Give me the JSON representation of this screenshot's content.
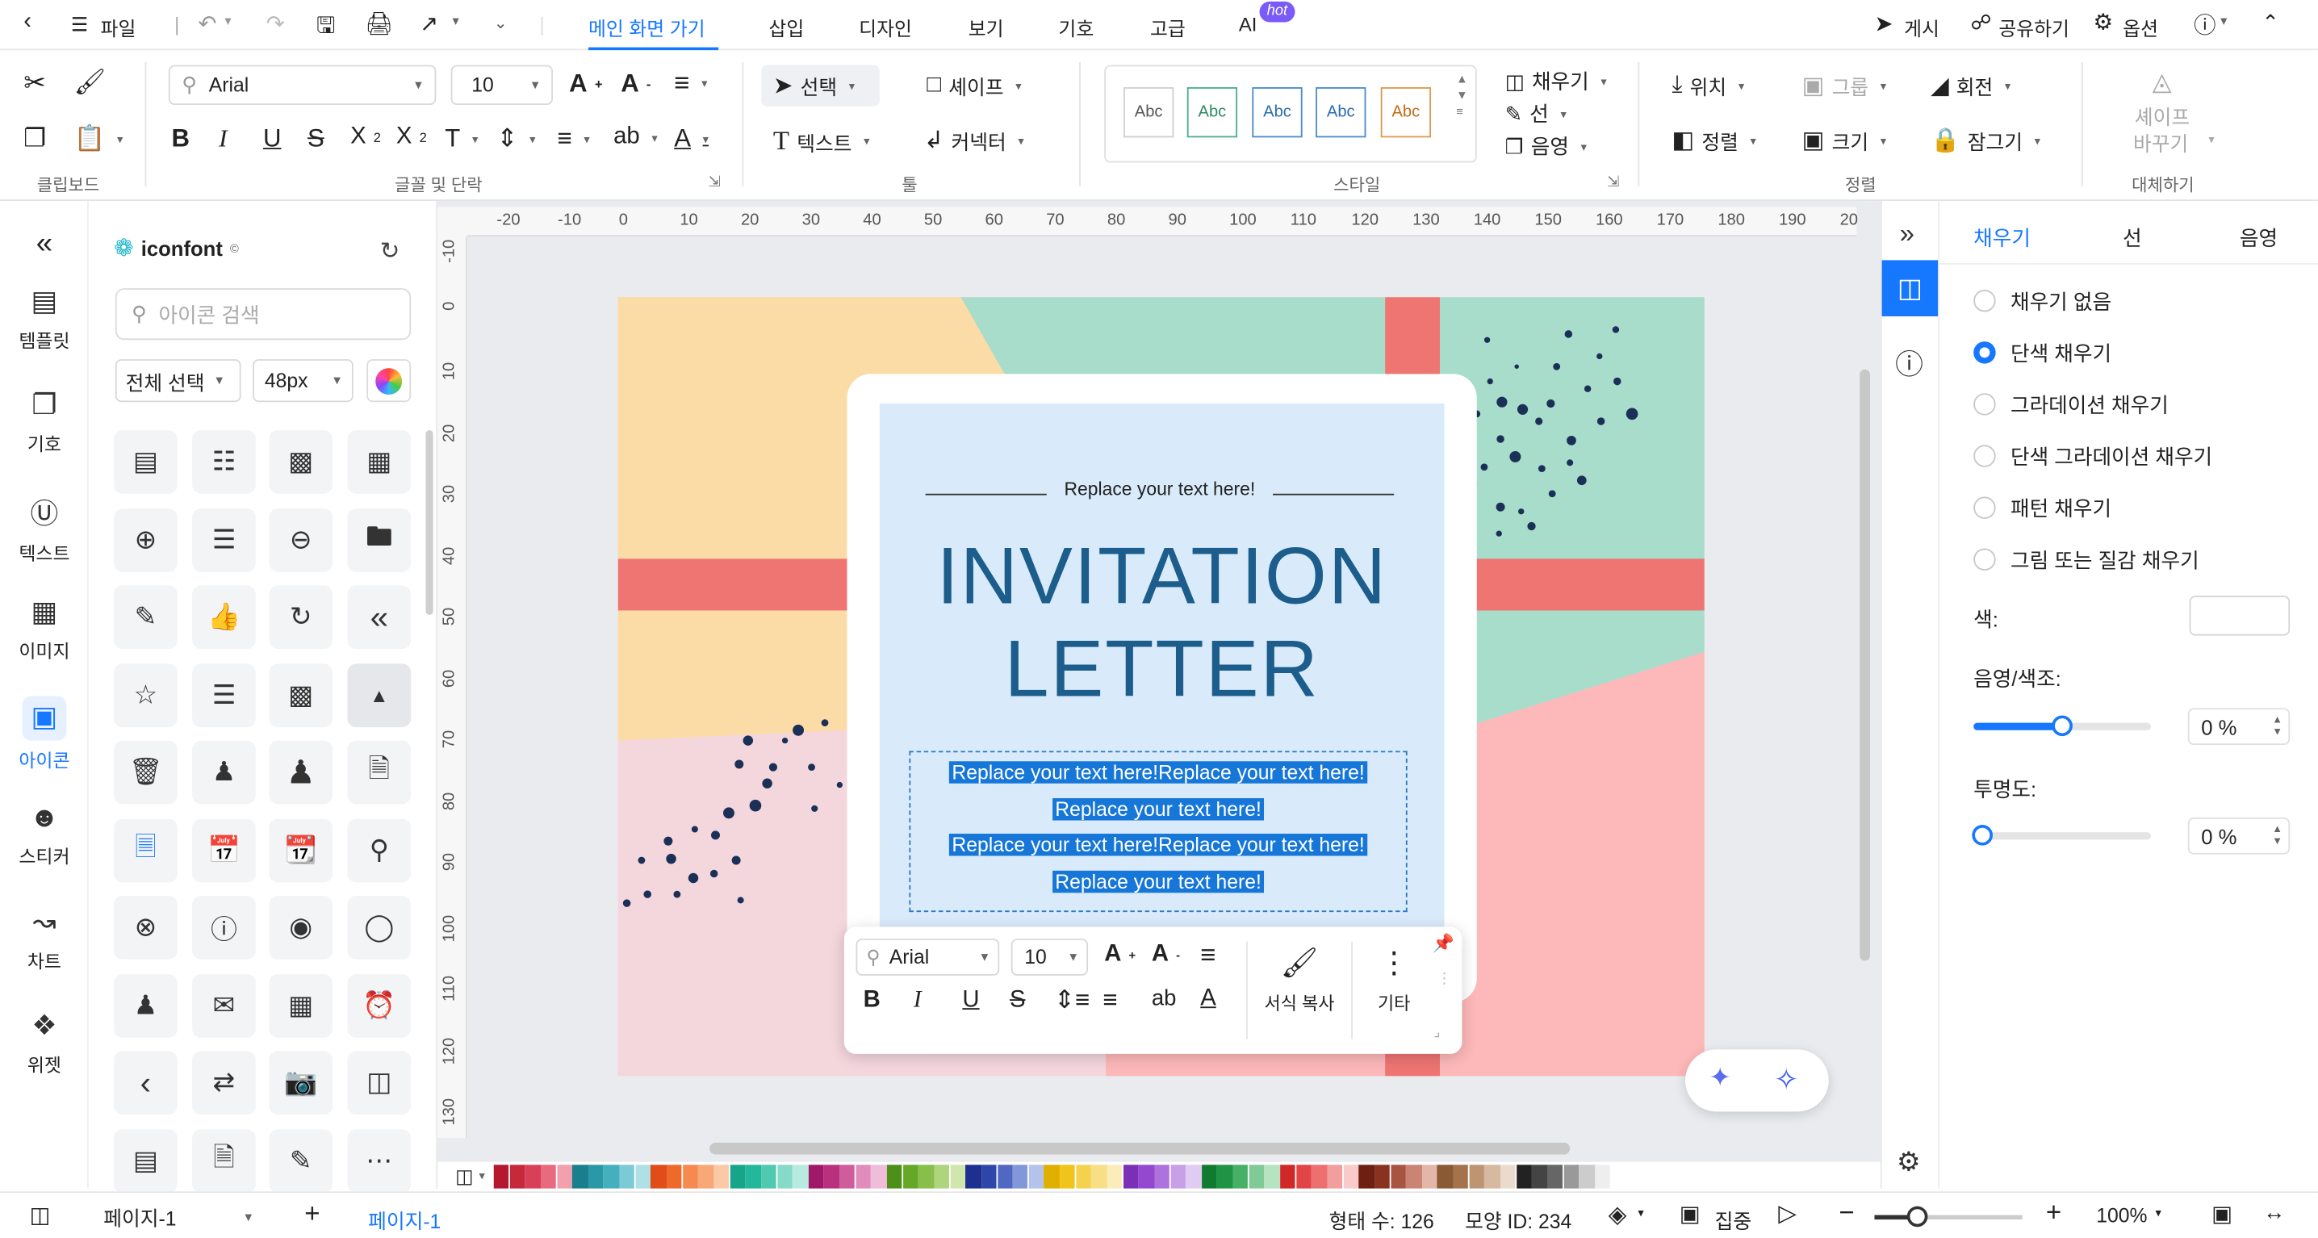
{
  "menu": {
    "file": "파일",
    "tabs": [
      "메인 화면 가기",
      "삽입",
      "디자인",
      "보기",
      "기호",
      "고급",
      "AI"
    ],
    "hot_badge": "hot",
    "right": [
      "게시",
      "공유하기",
      "옵션"
    ]
  },
  "ribbon": {
    "font_name": "Arial",
    "font_size": "10",
    "select": "선택",
    "shape": "셰이프",
    "text": "텍스트",
    "connector": "커넥터",
    "style_samples": [
      "Abc",
      "Abc",
      "Abc",
      "Abc",
      "Abc"
    ],
    "fill": "채우기",
    "line": "선",
    "shadow": "음영",
    "position": "위치",
    "group": "그룹",
    "rotate": "회전",
    "align": "정렬",
    "size": "크기",
    "lock": "잠그기",
    "replace_shape_1": "셰이프",
    "replace_shape_2": "바꾸기",
    "groups": [
      "클립보드",
      "글꼴 및 단락",
      "툴",
      "스타일",
      "정렬",
      "대체하기"
    ]
  },
  "leftnav": [
    "템플릿",
    "기호",
    "텍스트",
    "이미지",
    "아이콘",
    "스티커",
    "차트",
    "위젯"
  ],
  "iconpanel": {
    "brand": "iconfont",
    "search_placeholder": "아이콘 검색",
    "select_all": "전체 선택",
    "size": "48px"
  },
  "ruler_top": [
    "-20",
    "-10",
    "0",
    "10",
    "20",
    "30",
    "40",
    "50",
    "60",
    "70",
    "80",
    "90",
    "100",
    "110",
    "120",
    "130",
    "140",
    "150",
    "160",
    "170",
    "180",
    "190",
    "20"
  ],
  "ruler_left": [
    "-10",
    "0",
    "10",
    "20",
    "30",
    "40",
    "50",
    "60",
    "70",
    "80",
    "90",
    "100",
    "110",
    "120",
    "130"
  ],
  "card": {
    "subtitle": "Replace your text here!",
    "title1": "INVITATION",
    "title2": "LETTER",
    "body": [
      "Replace your text here!Replace your text here!",
      "Replace your text here!",
      "Replace your text here!Replace your text here!",
      "Replace your text here!"
    ]
  },
  "float_toolbar": {
    "font": "Arial",
    "size": "10",
    "format_painter": "서식 복사",
    "more": "기타"
  },
  "rightpanel": {
    "tabs": [
      "채우기",
      "선",
      "음영"
    ],
    "options": [
      "채우기 없음",
      "단색 채우기",
      "그라데이션 채우기",
      "단색 그라데이션 채우기",
      "패턴 채우기",
      "그림 또는 질감 채우기"
    ],
    "selected_option": "단색 채우기",
    "color_label": "색:",
    "shade_label": "음영/색조:",
    "shade_value": "0 %",
    "shade_level": 0.5,
    "opacity_label": "투명도:",
    "opacity_value": "0 %",
    "opacity_level": 0.0
  },
  "palette": [
    "#b5172f",
    "#c8283c",
    "#d8405a",
    "#e86a7e",
    "#f2a0ae",
    "#1a7f8c",
    "#2a98a6",
    "#45b0bd",
    "#7ccad3",
    "#aee0e6",
    "#e04d18",
    "#ee6a2a",
    "#f5894f",
    "#f8a877",
    "#fbc9a6",
    "#17a589",
    "#23b89b",
    "#4fc9b0",
    "#85dac8",
    "#b8ebdf",
    "#a01868",
    "#b9307f",
    "#cf5c9c",
    "#e08dbb",
    "#efbdd9",
    "#4d8f18",
    "#65a828",
    "#88bf4a",
    "#aed47c",
    "#d0e6ad",
    "#1d2f8f",
    "#2e46aa",
    "#5068c2",
    "#8297d8",
    "#b5c2ea",
    "#e0b000",
    "#f0c419",
    "#f5d24e",
    "#f8df86",
    "#fbecbb",
    "#7b2fb7",
    "#9448cf",
    "#ad72dc",
    "#c8a0e8",
    "#e0cbf3",
    "#107a30",
    "#209444",
    "#48af66",
    "#80cb95",
    "#b6e3c1",
    "#d02828",
    "#e24545",
    "#ec7070",
    "#f29e9e",
    "#f8caca",
    "#6e1f12",
    "#8a3220",
    "#a85443",
    "#c98474",
    "#e4b6aa",
    "#8a5a35",
    "#a5734b",
    "#be9573",
    "#d6b9a0",
    "#ebdbcd",
    "#222222",
    "#444444",
    "#666666",
    "#999999",
    "#cccccc",
    "#eeeeee"
  ],
  "status": {
    "page_select": "페이지-1",
    "page_tab": "페이지-1",
    "shape_count": "형태 수: 126",
    "shape_id": "모양 ID: 234",
    "focus": "집중",
    "zoom": "100%"
  },
  "colors": {
    "accent": "#1677ff",
    "title": "#1c5d8c",
    "card_bg": "#d9ebfb",
    "yellow": "#fcdca6",
    "mint": "#a8dccb",
    "pink": "#fdb8b9",
    "coral": "#ef7572",
    "blush": "#f4d6dd",
    "dots": "#1b3057"
  }
}
